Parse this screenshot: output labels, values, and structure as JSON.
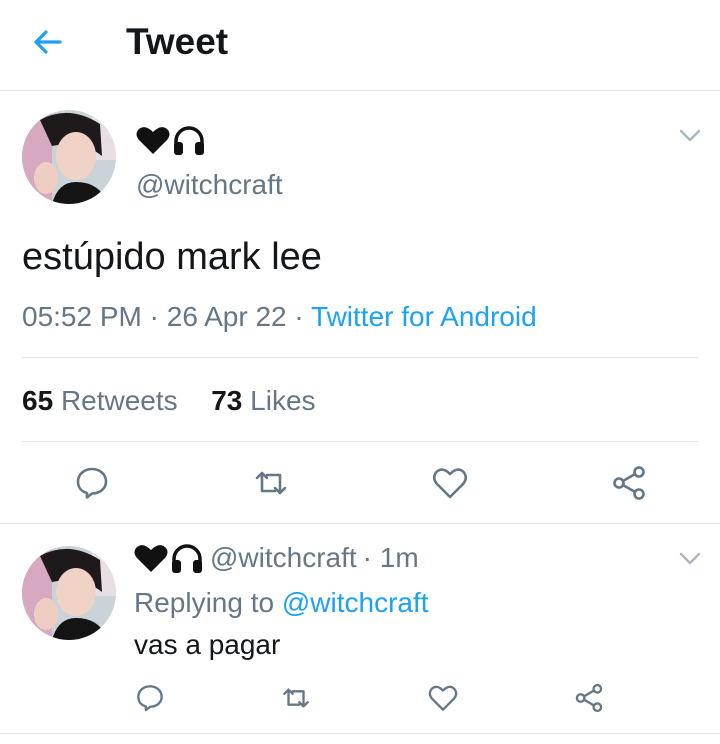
{
  "header": {
    "title": "Tweet",
    "back_icon": "arrow-left-icon"
  },
  "colors": {
    "accent": "#1da1f2",
    "muted": "#657786",
    "text": "#14171a",
    "divider": "#e1e8ed"
  },
  "tweet": {
    "display_name_icons": [
      "black-heart-icon",
      "headphones-icon"
    ],
    "handle": "@witchcraft",
    "text": "estúpido mark lee",
    "time": "05:52 PM",
    "sep1": " · ",
    "date": "26 Apr 22",
    "sep2": " · ",
    "source": "Twitter for Android",
    "retweets_count": "65",
    "retweets_label": "Retweets",
    "likes_count": "73",
    "likes_label": "Likes"
  },
  "reply": {
    "display_name_icons": [
      "black-heart-icon",
      "headphones-icon"
    ],
    "handle": "@witchcraft",
    "time": "· 1m",
    "replying_label": "Replying to",
    "replying_handle": "@witchcraft",
    "text": "vas a pagar"
  }
}
